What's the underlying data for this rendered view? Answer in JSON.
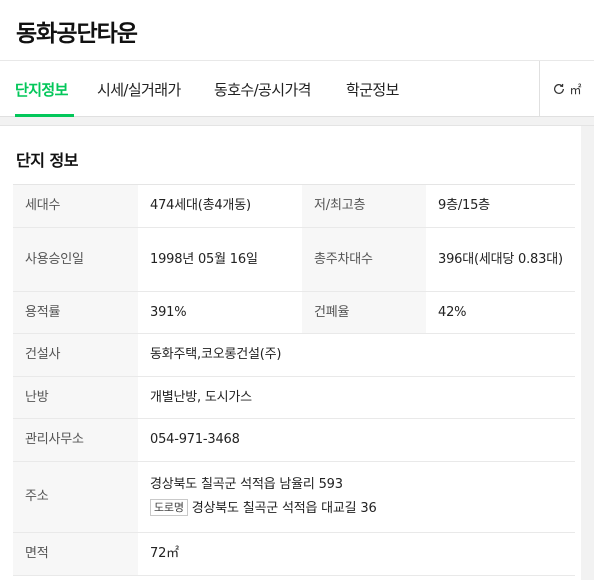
{
  "header": {
    "title": "동화공단타운"
  },
  "tabs": [
    {
      "label": "단지정보",
      "active": true
    },
    {
      "label": "시세/실거래가",
      "active": false
    },
    {
      "label": "동호수/공시가격",
      "active": false
    },
    {
      "label": "학군정보",
      "active": false
    }
  ],
  "unit_toggle": {
    "label": "㎡",
    "icon": "refresh-icon"
  },
  "section": {
    "title": "단지 정보"
  },
  "rows": {
    "households": {
      "label": "세대수",
      "value": "474세대(총4개동)"
    },
    "floors": {
      "label": "저/최고층",
      "value": "9층/15층"
    },
    "approval": {
      "label": "사용승인일",
      "value": "1998년 05월 16일"
    },
    "parking": {
      "label": "총주차대수",
      "value": "396대(세대당 0.83대)"
    },
    "far": {
      "label": "용적률",
      "value": "391%"
    },
    "bcr": {
      "label": "건폐율",
      "value": "42%"
    },
    "builder": {
      "label": "건설사",
      "value": "동화주택,코오롱건설(주)"
    },
    "heating": {
      "label": "난방",
      "value": "개별난방, 도시가스"
    },
    "office": {
      "label": "관리사무소",
      "value": "054-971-3468"
    },
    "address": {
      "label": "주소",
      "lot": "경상북도 칠곡군 석적읍 남율리 593",
      "road_tag": "도로명",
      "road": "경상북도 칠곡군 석적읍 대교길 36"
    },
    "area": {
      "label": "면적",
      "value": "72㎡"
    }
  },
  "colors": {
    "accent": "#03c75a",
    "label_bg": "#f7f7f7",
    "band": "#f2f2f2"
  }
}
